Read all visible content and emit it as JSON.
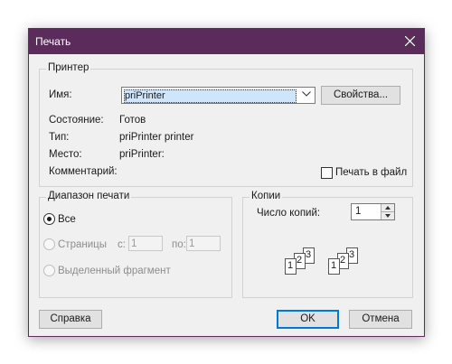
{
  "window": {
    "title": "Печать"
  },
  "printer": {
    "group_label": "Принтер",
    "name_label": "Имя:",
    "name_value": "priPrinter",
    "properties_button": "Свойства...",
    "status_label": "Состояние:",
    "status_value": "Готов",
    "type_label": "Тип:",
    "type_value": "priPrinter printer",
    "where_label": "Место:",
    "where_value": "priPrinter:",
    "comment_label": "Комментарий:",
    "print_to_file_label": "Печать в файл"
  },
  "range": {
    "group_label": "Диапазон печати",
    "all_label": "Все",
    "pages_label": "Страницы",
    "from_label": "с:",
    "from_value": "1",
    "to_label": "по:",
    "to_value": "1",
    "selection_label": "Выделенный фрагмент"
  },
  "copies": {
    "group_label": "Копии",
    "count_label": "Число копий:",
    "count_value": "1",
    "collate_pages": [
      "1",
      "2",
      "3"
    ]
  },
  "footer": {
    "help_button": "Справка",
    "ok_button": "OK",
    "cancel_button": "Отмена"
  },
  "colors": {
    "titlebar": "#5b2b5b",
    "accent": "#0078d7"
  }
}
